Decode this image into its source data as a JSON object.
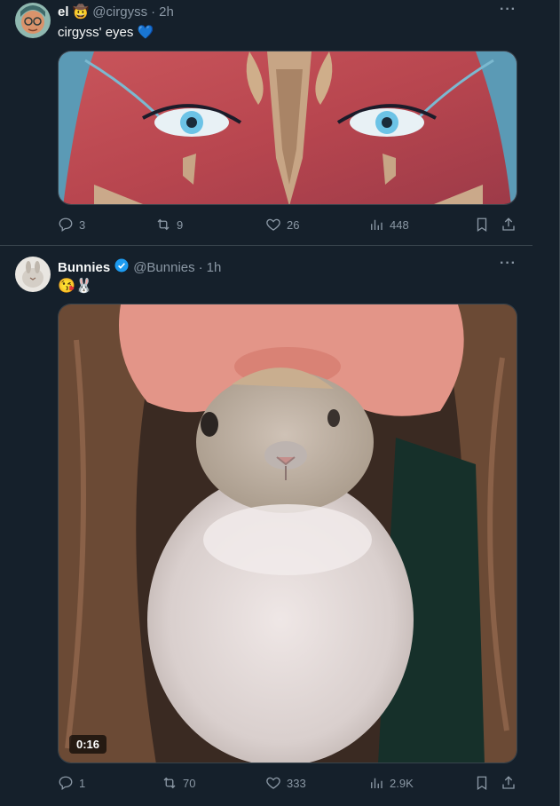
{
  "tweets": [
    {
      "display_name": "el",
      "name_emoji": "🤠",
      "handle": "@cirgyss",
      "dot": "·",
      "time": "2h",
      "text": "cirgyss' eyes 💙",
      "more_icon": "···",
      "replies": "3",
      "retweets": "9",
      "likes": "26",
      "views": "448"
    },
    {
      "display_name": "Bunnies",
      "verified": true,
      "handle": "@Bunnies",
      "dot": "·",
      "time": "1h",
      "text": "😘🐰",
      "more_icon": "···",
      "video_duration": "0:16",
      "replies": "1",
      "retweets": "70",
      "likes": "333",
      "views": "2.9K"
    }
  ],
  "colors": {
    "background": "#15202b",
    "border": "#38444d",
    "secondary_text": "#8b98a5",
    "verified": "#1d9bf0"
  }
}
